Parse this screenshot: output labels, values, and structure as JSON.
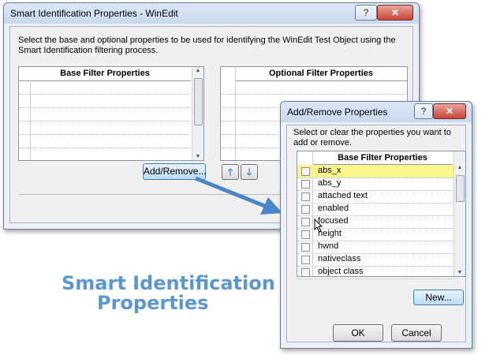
{
  "main_dialog": {
    "title": "Smart Identification Properties - WinEdit",
    "help_glyph": "?",
    "close_glyph": "✕",
    "description": "Select the base and optional properties to be used for identifying the WinEdit Test Object using the Smart Identification filtering process.",
    "base_grid_header": "Base Filter Properties",
    "optional_grid_header": "Optional Filter Properties",
    "add_remove_label": "Add/Remove...",
    "up_glyph": "🡑",
    "down_glyph": "🡓"
  },
  "sub_dialog": {
    "title": "Add/Remove Properties",
    "help_glyph": "?",
    "close_glyph": "✕",
    "description": "Select or clear the properties you want to add or remove.",
    "list_header": "Base Filter Properties",
    "properties": [
      {
        "name": "abs_x",
        "checked": false,
        "selected": true
      },
      {
        "name": "abs_y",
        "checked": false,
        "selected": false
      },
      {
        "name": "attached text",
        "checked": false,
        "selected": false
      },
      {
        "name": "enabled",
        "checked": false,
        "selected": false
      },
      {
        "name": "focused",
        "checked": false,
        "selected": false
      },
      {
        "name": "height",
        "checked": false,
        "selected": false
      },
      {
        "name": "hwnd",
        "checked": false,
        "selected": false
      },
      {
        "name": "nativeclass",
        "checked": false,
        "selected": false
      },
      {
        "name": "object class",
        "checked": false,
        "selected": false
      }
    ],
    "new_label": "New...",
    "ok_label": "OK",
    "cancel_label": "Cancel"
  },
  "callout": {
    "line1": "Smart Identification",
    "line2": "Properties",
    "color": "#5b96cf"
  },
  "colors": {
    "selected_row": "#fbf68b",
    "arrow": "#4a86c5"
  }
}
